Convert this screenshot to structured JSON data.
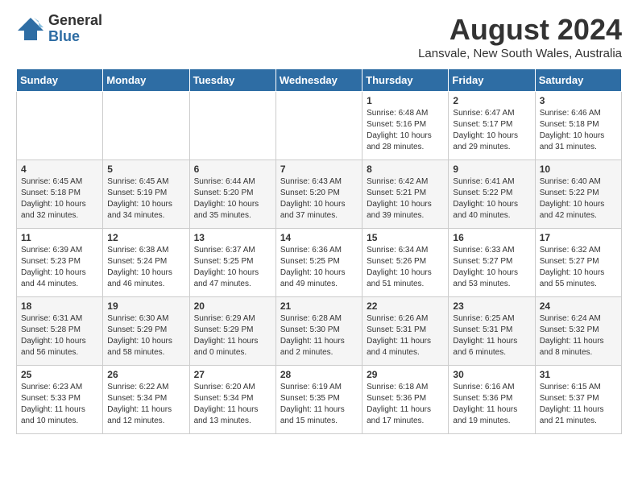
{
  "header": {
    "logo_general": "General",
    "logo_blue": "Blue",
    "month_year": "August 2024",
    "location": "Lansvale, New South Wales, Australia"
  },
  "weekdays": [
    "Sunday",
    "Monday",
    "Tuesday",
    "Wednesday",
    "Thursday",
    "Friday",
    "Saturday"
  ],
  "weeks": [
    [
      {
        "day": "",
        "info": ""
      },
      {
        "day": "",
        "info": ""
      },
      {
        "day": "",
        "info": ""
      },
      {
        "day": "",
        "info": ""
      },
      {
        "day": "1",
        "info": "Sunrise: 6:48 AM\nSunset: 5:16 PM\nDaylight: 10 hours\nand 28 minutes."
      },
      {
        "day": "2",
        "info": "Sunrise: 6:47 AM\nSunset: 5:17 PM\nDaylight: 10 hours\nand 29 minutes."
      },
      {
        "day": "3",
        "info": "Sunrise: 6:46 AM\nSunset: 5:18 PM\nDaylight: 10 hours\nand 31 minutes."
      }
    ],
    [
      {
        "day": "4",
        "info": "Sunrise: 6:45 AM\nSunset: 5:18 PM\nDaylight: 10 hours\nand 32 minutes."
      },
      {
        "day": "5",
        "info": "Sunrise: 6:45 AM\nSunset: 5:19 PM\nDaylight: 10 hours\nand 34 minutes."
      },
      {
        "day": "6",
        "info": "Sunrise: 6:44 AM\nSunset: 5:20 PM\nDaylight: 10 hours\nand 35 minutes."
      },
      {
        "day": "7",
        "info": "Sunrise: 6:43 AM\nSunset: 5:20 PM\nDaylight: 10 hours\nand 37 minutes."
      },
      {
        "day": "8",
        "info": "Sunrise: 6:42 AM\nSunset: 5:21 PM\nDaylight: 10 hours\nand 39 minutes."
      },
      {
        "day": "9",
        "info": "Sunrise: 6:41 AM\nSunset: 5:22 PM\nDaylight: 10 hours\nand 40 minutes."
      },
      {
        "day": "10",
        "info": "Sunrise: 6:40 AM\nSunset: 5:22 PM\nDaylight: 10 hours\nand 42 minutes."
      }
    ],
    [
      {
        "day": "11",
        "info": "Sunrise: 6:39 AM\nSunset: 5:23 PM\nDaylight: 10 hours\nand 44 minutes."
      },
      {
        "day": "12",
        "info": "Sunrise: 6:38 AM\nSunset: 5:24 PM\nDaylight: 10 hours\nand 46 minutes."
      },
      {
        "day": "13",
        "info": "Sunrise: 6:37 AM\nSunset: 5:25 PM\nDaylight: 10 hours\nand 47 minutes."
      },
      {
        "day": "14",
        "info": "Sunrise: 6:36 AM\nSunset: 5:25 PM\nDaylight: 10 hours\nand 49 minutes."
      },
      {
        "day": "15",
        "info": "Sunrise: 6:34 AM\nSunset: 5:26 PM\nDaylight: 10 hours\nand 51 minutes."
      },
      {
        "day": "16",
        "info": "Sunrise: 6:33 AM\nSunset: 5:27 PM\nDaylight: 10 hours\nand 53 minutes."
      },
      {
        "day": "17",
        "info": "Sunrise: 6:32 AM\nSunset: 5:27 PM\nDaylight: 10 hours\nand 55 minutes."
      }
    ],
    [
      {
        "day": "18",
        "info": "Sunrise: 6:31 AM\nSunset: 5:28 PM\nDaylight: 10 hours\nand 56 minutes."
      },
      {
        "day": "19",
        "info": "Sunrise: 6:30 AM\nSunset: 5:29 PM\nDaylight: 10 hours\nand 58 minutes."
      },
      {
        "day": "20",
        "info": "Sunrise: 6:29 AM\nSunset: 5:29 PM\nDaylight: 11 hours\nand 0 minutes."
      },
      {
        "day": "21",
        "info": "Sunrise: 6:28 AM\nSunset: 5:30 PM\nDaylight: 11 hours\nand 2 minutes."
      },
      {
        "day": "22",
        "info": "Sunrise: 6:26 AM\nSunset: 5:31 PM\nDaylight: 11 hours\nand 4 minutes."
      },
      {
        "day": "23",
        "info": "Sunrise: 6:25 AM\nSunset: 5:31 PM\nDaylight: 11 hours\nand 6 minutes."
      },
      {
        "day": "24",
        "info": "Sunrise: 6:24 AM\nSunset: 5:32 PM\nDaylight: 11 hours\nand 8 minutes."
      }
    ],
    [
      {
        "day": "25",
        "info": "Sunrise: 6:23 AM\nSunset: 5:33 PM\nDaylight: 11 hours\nand 10 minutes."
      },
      {
        "day": "26",
        "info": "Sunrise: 6:22 AM\nSunset: 5:34 PM\nDaylight: 11 hours\nand 12 minutes."
      },
      {
        "day": "27",
        "info": "Sunrise: 6:20 AM\nSunset: 5:34 PM\nDaylight: 11 hours\nand 13 minutes."
      },
      {
        "day": "28",
        "info": "Sunrise: 6:19 AM\nSunset: 5:35 PM\nDaylight: 11 hours\nand 15 minutes."
      },
      {
        "day": "29",
        "info": "Sunrise: 6:18 AM\nSunset: 5:36 PM\nDaylight: 11 hours\nand 17 minutes."
      },
      {
        "day": "30",
        "info": "Sunrise: 6:16 AM\nSunset: 5:36 PM\nDaylight: 11 hours\nand 19 minutes."
      },
      {
        "day": "31",
        "info": "Sunrise: 6:15 AM\nSunset: 5:37 PM\nDaylight: 11 hours\nand 21 minutes."
      }
    ]
  ]
}
